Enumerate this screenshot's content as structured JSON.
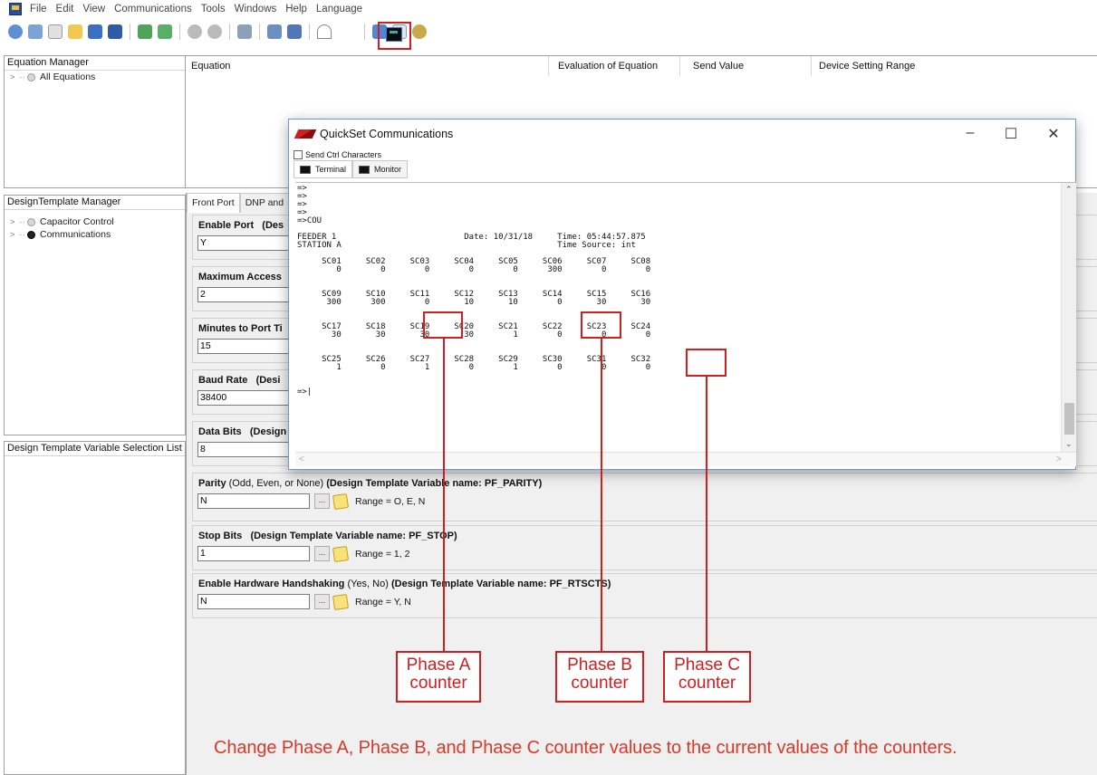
{
  "menu": [
    "File",
    "Edit",
    "View",
    "Communications",
    "Tools",
    "Windows",
    "Help",
    "Language"
  ],
  "equation_manager": {
    "title": "Equation Manager",
    "items": [
      {
        "label": "All Equations"
      }
    ]
  },
  "equation_table": {
    "columns": [
      "Equation",
      "Evaluation of Equation",
      "Send Value",
      "Device Setting Range"
    ]
  },
  "design_template_manager": {
    "title": "DesignTemplate Manager",
    "items": [
      {
        "label": "Capacitor Control"
      },
      {
        "label": "Communications"
      }
    ]
  },
  "variable_list": {
    "title": "Design Template Variable Selection List"
  },
  "settings": {
    "tabs": [
      "Front Port",
      "DNP and"
    ],
    "fields": [
      {
        "label_bold": "Enable Port",
        "label_suffix": "(Des",
        "value": "Y"
      },
      {
        "label_bold": "Maximum Access",
        "label_suffix": "",
        "value": "2"
      },
      {
        "label_bold": "Minutes to Port Ti",
        "label_suffix": "",
        "value": "15"
      },
      {
        "label_bold": "Baud Rate",
        "label_suffix": "(Desi",
        "value": "38400"
      },
      {
        "label_bold": "Data Bits",
        "label_suffix": "(Design",
        "value": "8"
      },
      {
        "label_bold": "Parity",
        "label_normal": "(Odd, Even, or None)",
        "label_var": "(Design Template Variable name: PF_PARITY)",
        "value": "N",
        "range": "Range = O, E, N"
      },
      {
        "label_bold": "Stop Bits",
        "label_normal": "",
        "label_var": "(Design Template Variable name: PF_STOP)",
        "value": "1",
        "range": "Range = 1, 2"
      },
      {
        "label_bold": "Enable Hardware Handshaking",
        "label_normal": "(Yes, No)",
        "label_var": "(Design Template Variable name: PF_RTSCTS)",
        "value": "N",
        "range": "Range = Y, N"
      }
    ]
  },
  "quickset": {
    "title": "QuickSet Communications",
    "send_ctrl": "Send Ctrl Characters",
    "tabs": [
      "Terminal",
      "Monitor"
    ],
    "terminal_lines": [
      "=>",
      "=>",
      "=>",
      "=>",
      "=>COU",
      "",
      "FEEDER 1                          Date: 10/31/18     Time: 05:44:57.875",
      "STATION A                                            Time Source: int",
      "",
      "     SC01     SC02     SC03     SC04     SC05     SC06     SC07     SC08",
      "        0        0        0        0        0      300        0        0",
      "",
      "",
      "     SC09     SC10     SC11     SC12     SC13     SC14     SC15     SC16",
      "      300      300        0       10       10        0       30       30",
      "",
      "",
      "     SC17     SC18     SC19     SC20     SC21     SC22     SC23     SC24",
      "       30       30       30       30        1        0        0        0",
      "",
      "",
      "     SC25     SC26     SC27     SC28     SC29     SC30     SC31     SC32",
      "        1        0        1        0        1        0        0        0",
      "",
      "",
      "=>|"
    ]
  },
  "callouts": {
    "phase_a": "Phase A counter",
    "phase_b": "Phase B counter",
    "phase_c": "Phase C counter"
  },
  "instruction": "Change Phase A, Phase B, and Phase C counter values to the current values of the counters.",
  "colors": {
    "highlight": "#d01f1f",
    "instruction": "#d63a2a"
  }
}
